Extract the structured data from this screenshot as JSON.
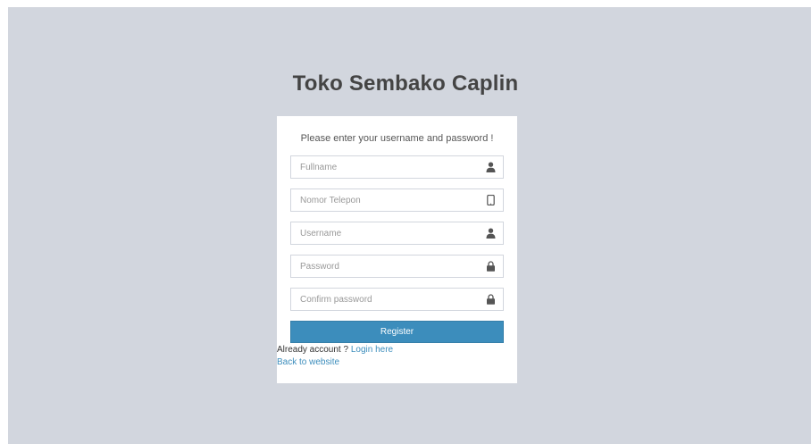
{
  "app": {
    "title": "Toko Sembako Caplin"
  },
  "register_box": {
    "message": "Please enter your username and password !",
    "fields": [
      {
        "placeholder": "Fullname",
        "value": "",
        "icon": "user-icon"
      },
      {
        "placeholder": "Nomor Telepon",
        "value": "",
        "icon": "phone-icon"
      },
      {
        "placeholder": "Username",
        "value": "",
        "icon": "user-icon"
      },
      {
        "placeholder": "Password",
        "value": "",
        "icon": "lock-icon"
      },
      {
        "placeholder": "Confirm password",
        "value": "",
        "icon": "lock-icon"
      }
    ],
    "register_label": "Register",
    "already_text": "Already account ?",
    "login_link": "Login here",
    "back_link": "Back to website"
  },
  "colors": {
    "page_background": "#d2d6de",
    "button_primary": "#3c8dbc",
    "link": "#3c8dbc",
    "icon": "#555555"
  }
}
